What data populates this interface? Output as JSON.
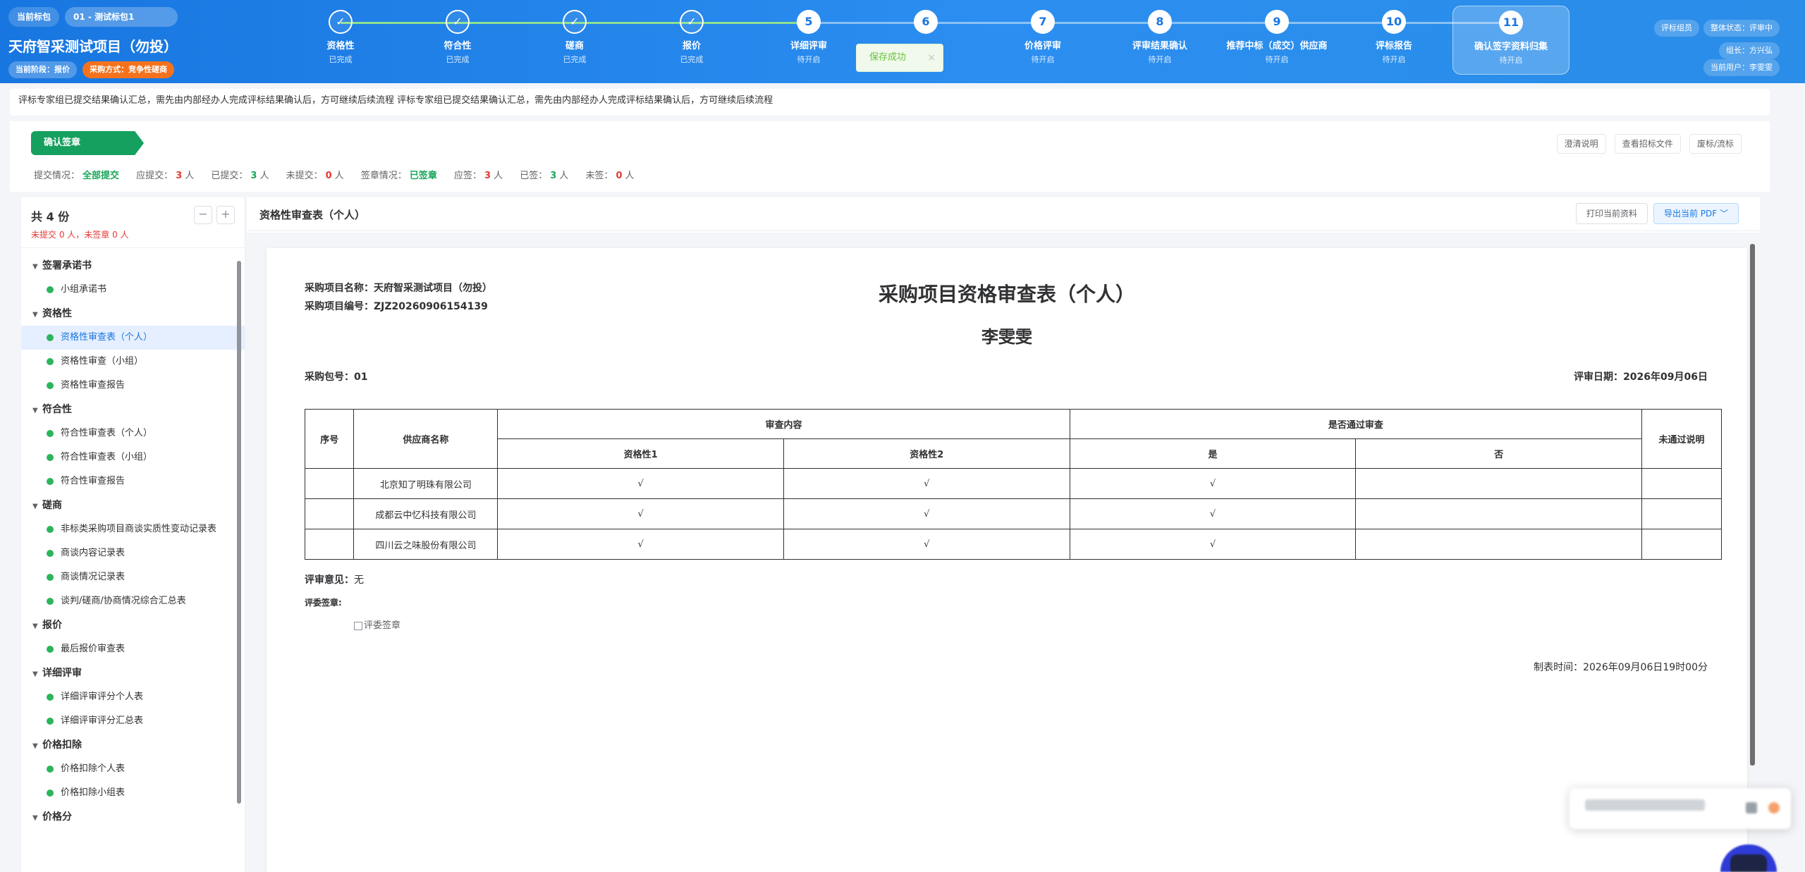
{
  "header": {
    "current_pkg_label": "当前标包",
    "current_pkg_value": "01 - 测试标包1",
    "project_title": "天府智采测试项目（勿投）",
    "stage_tag": "当前阶段：报价",
    "method_tag": "采购方式：竞争性磋商",
    "steps": [
      {
        "num": "✓",
        "label": "资格性",
        "status": "已完成"
      },
      {
        "num": "✓",
        "label": "符合性",
        "status": "已完成"
      },
      {
        "num": "✓",
        "label": "磋商",
        "status": "已完成"
      },
      {
        "num": "✓",
        "label": "报价",
        "status": "已完成"
      },
      {
        "num": "5",
        "label": "详细评审",
        "status": "待开启"
      },
      {
        "num": "6",
        "label": "",
        "status": ""
      },
      {
        "num": "7",
        "label": "价格评审",
        "status": "待开启"
      },
      {
        "num": "8",
        "label": "评审结果确认",
        "status": "待开启"
      },
      {
        "num": "9",
        "label": "推荐中标（成交）供应商",
        "status": "待开启"
      },
      {
        "num": "10",
        "label": "评标报告",
        "status": "待开启"
      },
      {
        "num": "11",
        "label": "确认签字资料归集",
        "status": "待开启"
      }
    ],
    "toast_text": "保存成功",
    "toast_close": "×",
    "role_chip": "评标组员",
    "overall_status": "整体状态：评审中",
    "leader": "组长：方兴弘",
    "current_user": "当前用户：李雯雯"
  },
  "notice": "评标专家组已提交结果确认汇总，需先由内部经办人完成评标结果确认后，方可继续后续流程 评标专家组已提交结果确认汇总，需先由内部经办人完成评标结果确认后，方可继续后续流程",
  "sign": {
    "tag": "确认签章",
    "links": [
      "澄清说明",
      "查看招标文件",
      "废标/流标"
    ],
    "stats": {
      "submit_label": "提交情况：",
      "submit_value": "全部提交",
      "should_label": "应提交：",
      "should_value": "3",
      "submitted_label": "已提交：",
      "submitted_value": "3",
      "unsubmitted_label": "未提交：",
      "unsubmitted_value": "0",
      "person": "人",
      "seal_label": "签章情况：",
      "seal_value": "已签章",
      "should_sign_label": "应签：",
      "should_sign_value": "3",
      "signed_label": "已签：",
      "signed_value": "3",
      "unsigned_label": "未签：",
      "unsigned_value": "0"
    }
  },
  "sidebar": {
    "total": "共 4 份",
    "sub": "未提交 0 人，未签章 0 人",
    "minus": "−",
    "plus": "+",
    "groups": [
      {
        "name": "签署承诺书",
        "items": [
          "小组承诺书"
        ]
      },
      {
        "name": "资格性",
        "items": [
          "资格性审查表（个人）",
          "资格性审查（小组）",
          "资格性审查报告"
        ]
      },
      {
        "name": "符合性",
        "items": [
          "符合性审查表（个人）",
          "符合性审查表（小组）",
          "符合性审查报告"
        ]
      },
      {
        "name": "磋商",
        "items": [
          "非标类采购项目商谈实质性变动记录表",
          "商谈内容记录表",
          "商谈情况记录表",
          "谈判/磋商/协商情况综合汇总表"
        ]
      },
      {
        "name": "报价",
        "items": [
          "最后报价审查表"
        ]
      },
      {
        "name": "详细评审",
        "items": [
          "详细评审评分个人表",
          "详细评审评分汇总表"
        ]
      },
      {
        "name": "价格扣除",
        "items": [
          "价格扣除个人表",
          "价格扣除小组表"
        ]
      },
      {
        "name": "价格分",
        "items": []
      }
    ]
  },
  "main": {
    "title": "资格性审查表（个人）",
    "print_btn": "打印当前资料",
    "export_btn": "导出当前 PDF ﹀"
  },
  "doc": {
    "project_name_label": "采购项目名称：",
    "project_name": "天府智采测试项目（勿投）",
    "project_code_label": "采购项目编号：",
    "project_code": "ZJZ20260906154139",
    "title": "采购项目资格审查表（个人）",
    "person": "李雯雯",
    "package_label": "采购包号：",
    "package": "01",
    "date_label": "评审日期：",
    "date": "2026年09月06日",
    "table": {
      "h_no": "序号",
      "h_supplier": "供应商名称",
      "h_content": "审查内容",
      "h_pass": "是否通过审查",
      "h_reason": "未通过说明",
      "h_q1": "资格性1",
      "h_q2": "资格性2",
      "h_yes": "是",
      "h_no2": "否",
      "rows": [
        {
          "no": "",
          "supplier": "北京知了明珠有限公司",
          "q1": "√",
          "q2": "√",
          "yes": "√",
          "reason": ""
        },
        {
          "no": "",
          "supplier": "成都云中忆科技有限公司",
          "q1": "√",
          "q2": "√",
          "yes": "√",
          "reason": ""
        },
        {
          "no": "",
          "supplier": "四川云之味股份有限公司",
          "q1": "√",
          "q2": "√",
          "yes": "√",
          "reason": ""
        }
      ]
    },
    "opinion_label": "评审意见：",
    "opinion": "无",
    "sign_label": "评委签章:",
    "sign_img_alt": "评委签章",
    "made_label": "制表时间：",
    "made_time": "2026年09月06日19时00分"
  }
}
